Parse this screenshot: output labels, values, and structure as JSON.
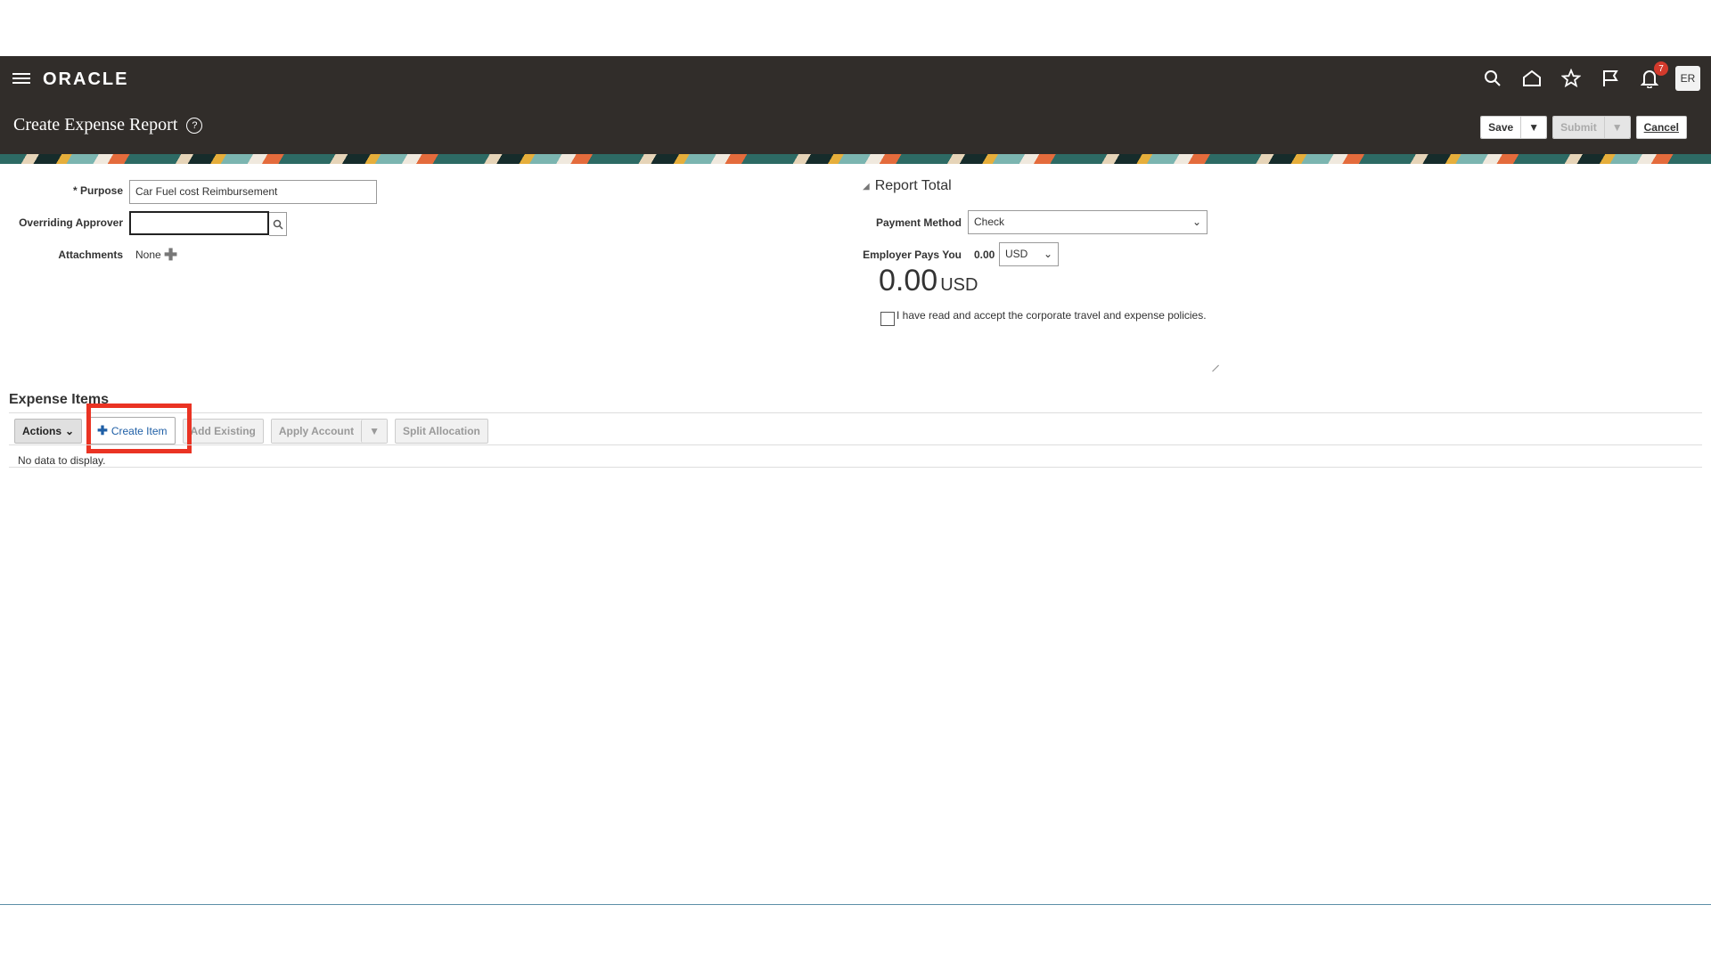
{
  "header": {
    "logo_text": "ORACLE",
    "notification_count": "7",
    "avatar_initials": "ER",
    "icons": [
      "search-icon",
      "home-icon",
      "star-icon",
      "flag-icon",
      "bell-icon"
    ],
    "page_title": "Create Expense Report",
    "help_symbol": "?",
    "save_label": "Save",
    "submit_label": "Submit",
    "cancel_label": "Cancel"
  },
  "form": {
    "purpose_required_mark": "*",
    "purpose_label": "Purpose",
    "purpose_value": "Car Fuel cost Reimbursement",
    "approver_label": "Overriding Approver",
    "approver_value": "",
    "attachments_label": "Attachments",
    "attachments_value": "None"
  },
  "report_total": {
    "section_title": "Report Total",
    "payment_method_label": "Payment Method",
    "payment_method_value": "Check",
    "employer_pays_label": "Employer Pays You",
    "employer_pays_amount": "0.00",
    "employer_pays_currency": "USD",
    "total_amount": "0.00",
    "total_currency": "USD",
    "policy_text": "I have read and accept the corporate travel and expense policies."
  },
  "expense_items": {
    "title": "Expense Items",
    "actions_label": "Actions",
    "create_item_label": "Create Item",
    "add_existing_label": "Add Existing",
    "apply_account_label": "Apply Account",
    "split_allocation_label": "Split Allocation",
    "empty_text": "No data to display."
  },
  "colors": {
    "header_bg": "#312d2a",
    "highlight": "#ea3323",
    "link_blue": "#1f5fa6"
  }
}
